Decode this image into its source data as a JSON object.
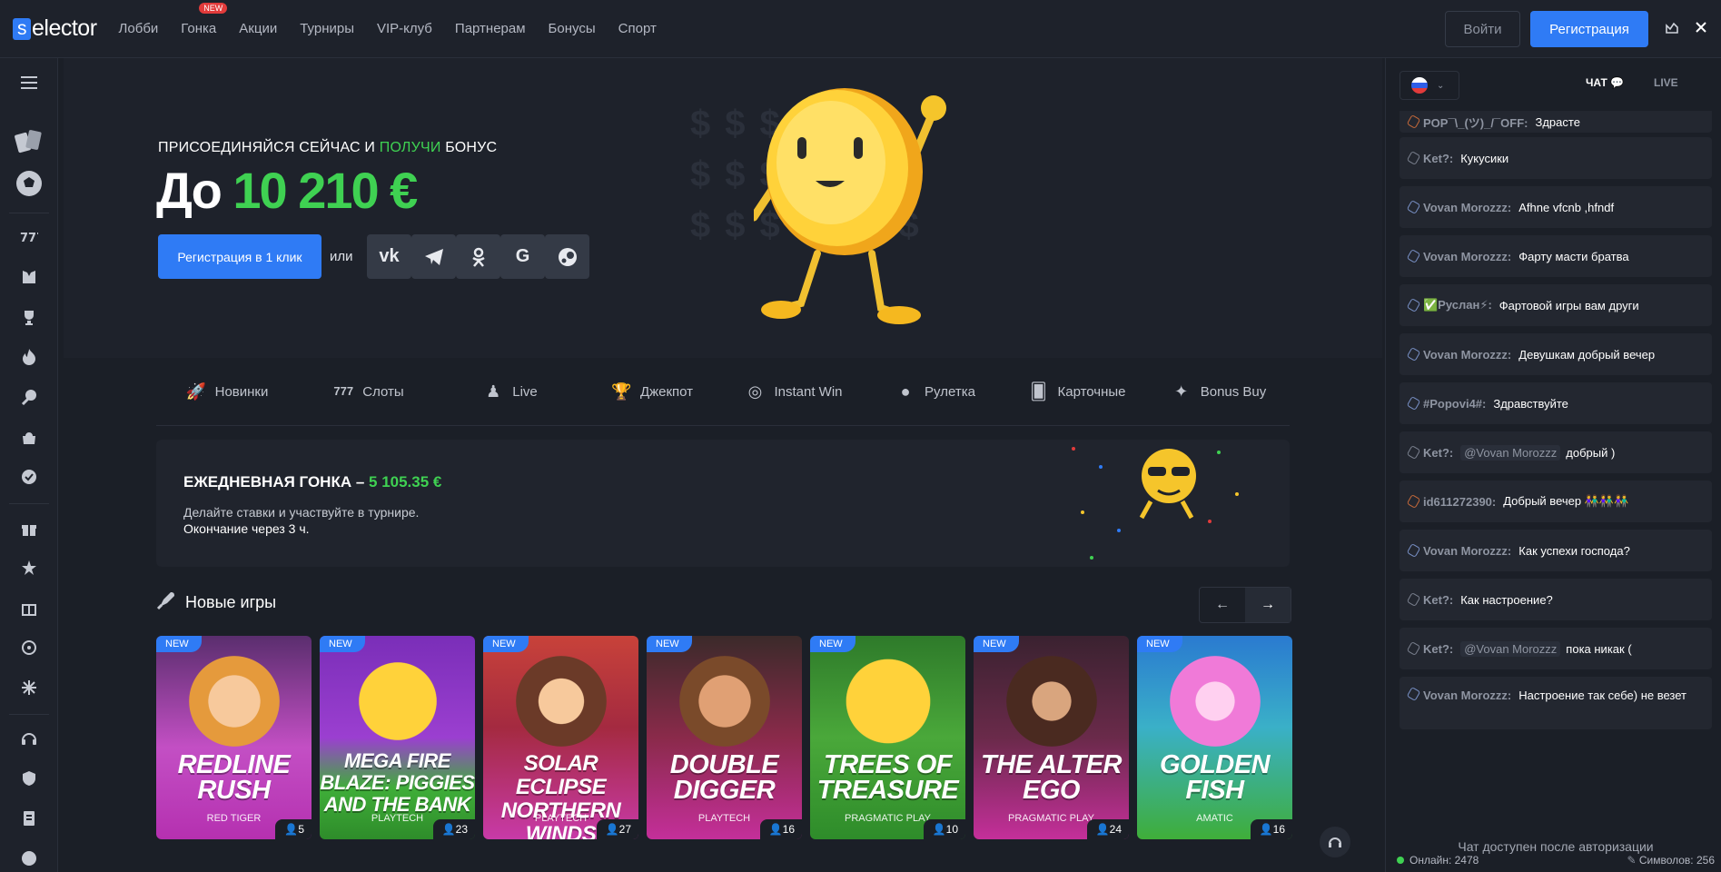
{
  "header": {
    "logo_s": "s",
    "logo_rest": "elector",
    "nav": [
      "Лобби",
      "Гонка",
      "Акции",
      "Турниры",
      "VIP-клуб",
      "Партнерам",
      "Бонусы",
      "Спорт"
    ],
    "new_tag": "NEW",
    "login": "Войти",
    "register": "Регистрация"
  },
  "hero": {
    "line1_a": "ПРИСОЕДИНЯЙСЯ СЕЙЧАС И ",
    "line1_b": "ПОЛУЧИ",
    "line1_c": " БОНУС",
    "amount_prefix": "До ",
    "amount": "10 210 €",
    "reg_button": "Регистрация в 1 клик",
    "or": "или",
    "socials": [
      "vk-icon",
      "telegram-icon",
      "odnoklassniki-icon",
      "google-icon",
      "steam-icon"
    ]
  },
  "categories": [
    "Новинки",
    "Слоты",
    "Live",
    "Джекпот",
    "Instant Win",
    "Рулетка",
    "Карточные",
    "Bonus Buy"
  ],
  "race": {
    "title": "ЕЖЕДНЕВНАЯ ГОНКА – ",
    "amount": "5 105.35 €",
    "desc1": "Делайте ставки и участвуйте в турнире.",
    "desc2": "Окончание через 3 ч."
  },
  "new_games": {
    "title": "Новые игры",
    "cards": [
      {
        "name": "REDLINE RUSH",
        "provider": "RED TIGER",
        "players": "5",
        "tag": "NEW"
      },
      {
        "name": "MEGA FIRE BLAZE: PIGGIES AND THE BANK",
        "provider": "PLAYTECH",
        "players": "23",
        "tag": "NEW"
      },
      {
        "name": "SOLAR ECLIPSE NORTHERN WINDS",
        "provider": "PLAYTECH",
        "players": "27",
        "tag": "NEW"
      },
      {
        "name": "DOUBLE DIGGER",
        "provider": "PLAYTECH",
        "players": "16",
        "tag": "NEW"
      },
      {
        "name": "TREES OF TREASURE",
        "provider": "PRAGMATIC PLAY",
        "players": "10",
        "tag": "NEW"
      },
      {
        "name": "THE ALTER EGO",
        "provider": "PRAGMATIC PLAY",
        "players": "24",
        "tag": "NEW"
      },
      {
        "name": "GOLDEN FISH",
        "provider": "AMATIC",
        "players": "16",
        "tag": "NEW"
      }
    ]
  },
  "chat": {
    "tab_chat": "ЧАТ",
    "tab_live": "LIVE",
    "messages": [
      {
        "user": "POP¯\\_(ツ)_/¯OFF:",
        "mention": "",
        "text": "Здрасте"
      },
      {
        "user": "Ket?:",
        "mention": "",
        "text": "Кукусики"
      },
      {
        "user": "Vovan Morozzz:",
        "mention": "",
        "text": "Afhne vfcnb ,hfndf"
      },
      {
        "user": "Vovan Morozzz:",
        "mention": "",
        "text": "Фарту масти братва"
      },
      {
        "user": "✅Руслан⚡:",
        "mention": "",
        "text": "Фартовой игры вам други"
      },
      {
        "user": "Vovan Morozzz:",
        "mention": "",
        "text": "Девушкам добрый вечер"
      },
      {
        "user": "#Popovi4#:",
        "mention": "",
        "text": "Здравствуйте"
      },
      {
        "user": "Ket?:",
        "mention": "@Vovan Morozzz",
        "text": "добрый )"
      },
      {
        "user": "id611272390:",
        "mention": "",
        "text": "Добрый вечер 👫👫👫"
      },
      {
        "user": "Vovan Morozzz:",
        "mention": "",
        "text": "Как успехи господа?"
      },
      {
        "user": "Ket?:",
        "mention": "",
        "text": "Как настроение?"
      },
      {
        "user": "Ket?:",
        "mention": "@Vovan Morozzz",
        "text": "пока никак ("
      },
      {
        "user": "Vovan Morozzz:",
        "mention": "",
        "text": "Настроение так себе) не везет"
      }
    ],
    "note": "Чат доступен после авторизации",
    "online": "Онлайн: 2478",
    "symbols": "Символов: 256"
  }
}
